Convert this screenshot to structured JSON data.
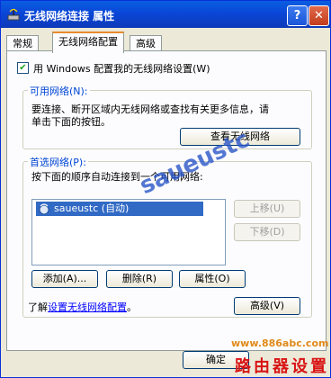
{
  "window": {
    "title": "无线网络连接 属性",
    "help_button": "?",
    "close_button": "✕"
  },
  "tabs": [
    {
      "label": "常规"
    },
    {
      "label": "无线网络配置"
    },
    {
      "label": "高级"
    }
  ],
  "checkbox": {
    "label": "用 Windows 配置我的无线网络设置(W)",
    "checked": true
  },
  "available": {
    "legend": "可用网络(N):",
    "text_line1": "要连接、断开区域内无线网络或查找有关更多信息，请",
    "text_line2": "单击下面的按钮。",
    "view_button": "查看无线网络"
  },
  "preferred": {
    "legend": "首选网络(P):",
    "text": "按下面的顺序自动连接到一个可用网络:",
    "networks": [
      {
        "name": "saueustc (自动)"
      }
    ],
    "move_up": "上移(U)",
    "move_down": "下移(D)",
    "add": "添加(A)...",
    "remove": "删除(R)",
    "properties": "属性(O)"
  },
  "learn": {
    "prefix": "了解",
    "link": "设置无线网络配置",
    "suffix": "。"
  },
  "advanced_button": "高级(V)",
  "ok_button": "确定",
  "watermarks": {
    "overlay": "saueustc",
    "url": "www.886abc.com",
    "site_name": "路由器设置"
  }
}
